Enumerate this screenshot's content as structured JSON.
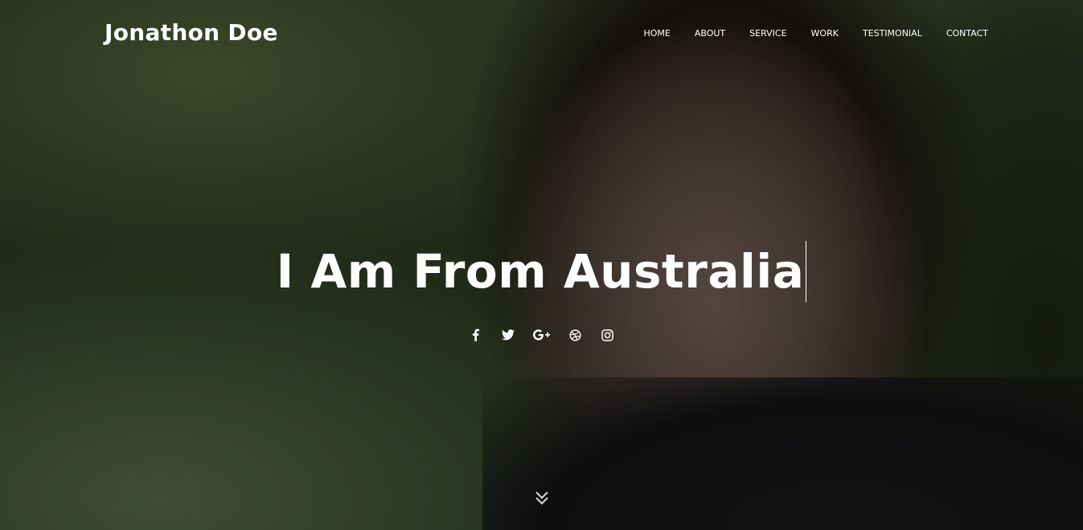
{
  "header": {
    "brand": "Jonathon Doe",
    "nav": [
      {
        "label": "HOME"
      },
      {
        "label": "ABOUT"
      },
      {
        "label": "SERVICE"
      },
      {
        "label": "WORK"
      },
      {
        "label": "TESTIMONIAL"
      },
      {
        "label": "CONTACT"
      }
    ]
  },
  "hero": {
    "headline": "I Am From Australia",
    "social": [
      {
        "icon": "facebook-icon"
      },
      {
        "icon": "twitter-icon"
      },
      {
        "icon": "google-plus-icon"
      },
      {
        "icon": "dribbble-icon"
      },
      {
        "icon": "instagram-icon"
      }
    ],
    "scroll_icon": "double-chevron-down-icon"
  },
  "colors": {
    "text": "#ffffff",
    "background_green": "#3c4a2b"
  }
}
